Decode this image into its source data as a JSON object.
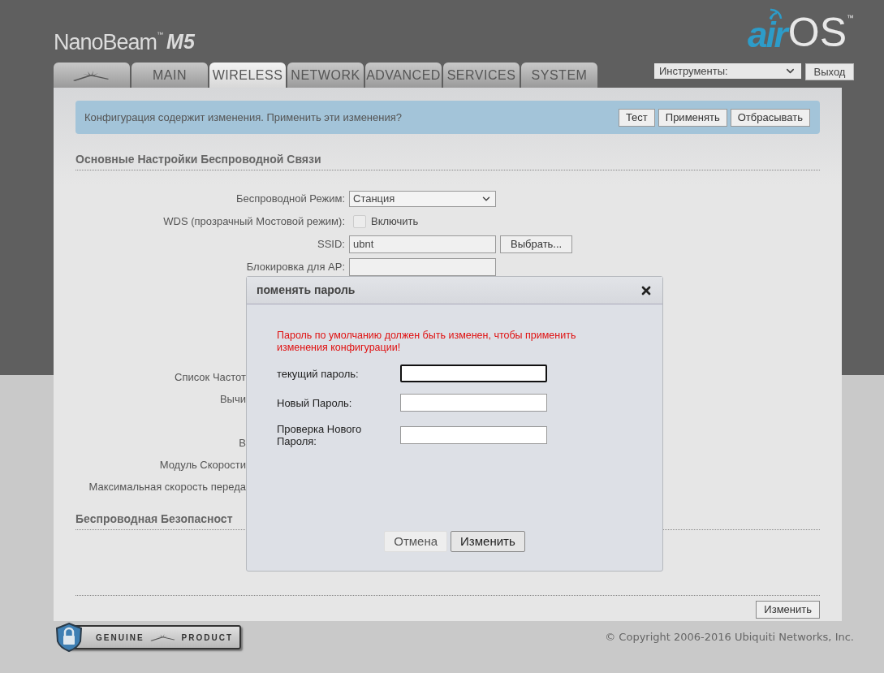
{
  "header": {
    "product_logo": {
      "name": "NanoBeam",
      "tm": "™",
      "model": "M5"
    },
    "os_logo": {
      "air": "air",
      "os": "OS",
      "tm": "™"
    },
    "tools_select": {
      "value": "Инструменты:"
    },
    "logout_button": "Выход"
  },
  "tabs": [
    {
      "kind": "icon",
      "selected": false
    },
    {
      "kind": "text",
      "label": "MAIN",
      "selected": false
    },
    {
      "kind": "text",
      "label": "WIRELESS",
      "selected": true
    },
    {
      "kind": "text",
      "label": "NETWORK",
      "selected": false
    },
    {
      "kind": "text",
      "label": "ADVANCED",
      "selected": false
    },
    {
      "kind": "text",
      "label": "SERVICES",
      "selected": false
    },
    {
      "kind": "text",
      "label": "SYSTEM",
      "selected": false
    }
  ],
  "notice": {
    "message": "Конфигурация содержит изменения. Применить эти изменения?",
    "buttons": [
      "Тест",
      "Применять",
      "Отбрасывать"
    ]
  },
  "section_title": "Основные Настройки Беспроводной Связи",
  "fields": [
    {
      "kind": "select",
      "label": "Беспроводной Режим:",
      "value": "Станция"
    },
    {
      "kind": "checkbox",
      "label": "WDS (прозрачный Мостовой режим):",
      "checked": false,
      "option": "Включить"
    },
    {
      "kind": "text",
      "label": "SSID:",
      "value": "ubnt",
      "button": "Выбрать..."
    },
    {
      "kind": "text",
      "label": "Блокировка для AP:"
    }
  ],
  "covered_labels": [
    "Список Частот",
    "Вычи",
    "В",
    "Модуль Скорости",
    "Максимальная скорость переда"
  ],
  "security_title": "Беспроводная Безопасност",
  "change_button": "Изменить",
  "footer": {
    "badge": [
      "GENUINE",
      "PRODUCT"
    ],
    "copyright": "© Copyright 2006-2016 Ubiquiti Networks, Inc."
  },
  "dialog": {
    "title": "поменять пароль",
    "message": "Пароль по умолчанию должен быть изменен, чтобы применить изменения конфигурации!",
    "fields": [
      {
        "label": "текущий пароль:",
        "focused": true
      },
      {
        "label": "Новый Пароль:",
        "focused": false
      },
      {
        "label": "Проверка Нового Пароля:",
        "focused": false
      }
    ],
    "buttons": [
      {
        "kind": "cancel",
        "label": "Отмена"
      },
      {
        "kind": "submit",
        "label": "Изменить"
      }
    ]
  }
}
